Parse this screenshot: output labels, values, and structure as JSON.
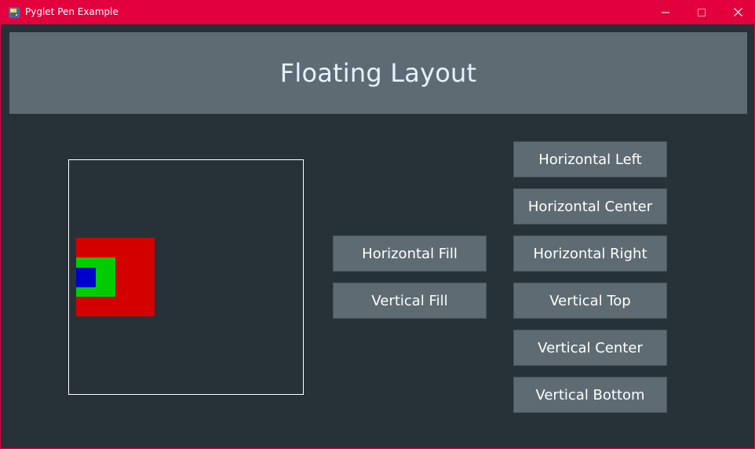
{
  "window": {
    "title": "Pyglet Pen Example",
    "accent_color": "#e2003d",
    "icons": [
      "python-icon",
      "minimize-icon",
      "maximize-icon",
      "close-icon"
    ]
  },
  "header": {
    "title": "Floating Layout"
  },
  "demo": {
    "outer_color": "#d40000",
    "middle_color": "#00cc00",
    "inner_color": "#0000cc"
  },
  "fill_buttons": {
    "horizontal_fill": "Horizontal Fill",
    "vertical_fill": "Vertical Fill"
  },
  "align_buttons": {
    "horizontal_left": "Horizontal Left",
    "horizontal_center": "Horizontal Center",
    "horizontal_right": "Horizontal Right",
    "vertical_top": "Vertical Top",
    "vertical_center": "Vertical Center",
    "vertical_bottom": "Vertical Bottom"
  }
}
